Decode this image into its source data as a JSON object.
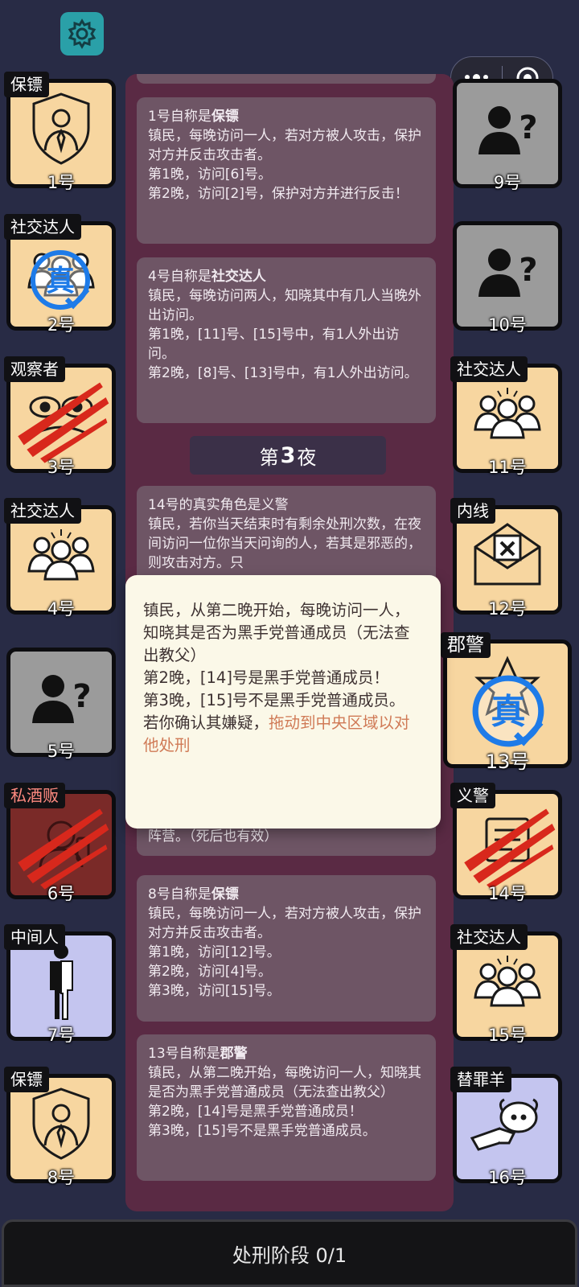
{
  "top": {
    "settings_icon": "gear-icon",
    "menu_icon": "more-dots-icon",
    "record_icon": "target-icon"
  },
  "cards": [
    {
      "lines": [
        "1号自称是",
        "镇民，每晚访问一人，若对方被人攻击，保护对方并反击攻击者。",
        "第1晚，访问[6]号。",
        "第2晚，访问[2]号，保护对方并进行反击！"
      ],
      "claim": "保镖"
    },
    {
      "lines": [
        "4号自称是",
        "镇民，每晚访问两人，知晓其中有几人当晚外出访问。",
        "第1晚，[11]号、[15]号中，有1人外出访问。",
        "第2晚，[8]号、[13]号中，有1人外出访问。"
      ],
      "claim": "社交达人"
    },
    {
      "lines": [
        "14号的真实角色是义警",
        "镇民，若你当天结束时有剩余处刑次数，在夜间访问一位你当天问询的人，若其是邪恶的，则攻击对方。只",
        "阵营。（死后也有效）"
      ]
    },
    {
      "lines": [
        "8号自称是",
        "镇民，每晚访问一人，若对方被人攻击，保护对方并反击攻击者。",
        "第1晚，访问[12]号。",
        "第2晚，访问[4]号。",
        "第3晚，访问[15]号。"
      ],
      "claim": "保镖"
    },
    {
      "lines": [
        "13号自称是",
        "镇民，从第二晚开始，每晚访问一人，知晓其是否为黑手党普通成员（无法查出教父）",
        "第2晚，[14]号是黑手党普通成员！",
        "第3晚，[15]号不是黑手党普通成员。"
      ],
      "claim": "郡警"
    }
  ],
  "night_divider": {
    "prefix": "第",
    "number": "3",
    "suffix": "夜"
  },
  "players": [
    {
      "num": "1号",
      "role": "保镖",
      "style": "peach",
      "portrait": "bodyguard-shield-icon"
    },
    {
      "num": "2号",
      "role": "社交达人",
      "style": "peach",
      "portrait": "crowd-icon",
      "truth": "真"
    },
    {
      "num": "3号",
      "role": "观察者",
      "style": "peach",
      "portrait": "observer-eyes-icon",
      "slashed": true
    },
    {
      "num": "4号",
      "role": "社交达人",
      "style": "peach",
      "portrait": "crowd-icon"
    },
    {
      "num": "5号",
      "role": "",
      "style": "gray",
      "portrait": "unknown-person-icon"
    },
    {
      "num": "6号",
      "role": "私酒贩",
      "style": "darkred",
      "portrait": "bootlegger-icon",
      "slashed": true,
      "role_color": "#ff8a80"
    },
    {
      "num": "7号",
      "role": "中间人",
      "style": "blue",
      "portrait": "middleman-figure-icon"
    },
    {
      "num": "8号",
      "role": "保镖",
      "style": "peach",
      "portrait": "bodyguard-shield-icon"
    },
    {
      "num": "9号",
      "role": "",
      "style": "gray",
      "portrait": "unknown-person-icon"
    },
    {
      "num": "10号",
      "role": "",
      "style": "gray",
      "portrait": "unknown-person-icon"
    },
    {
      "num": "11号",
      "role": "社交达人",
      "style": "peach",
      "portrait": "crowd-icon"
    },
    {
      "num": "12号",
      "role": "内线",
      "style": "peach",
      "portrait": "envelope-x-icon"
    },
    {
      "num": "13号",
      "role": "郡警",
      "style": "peach",
      "portrait": "sheriff-badge-icon",
      "truth": "真"
    },
    {
      "num": "14号",
      "role": "义警",
      "style": "peach",
      "portrait": "vigilante-icon",
      "slashed": true
    },
    {
      "num": "15号",
      "role": "社交达人",
      "style": "peach",
      "portrait": "crowd-icon"
    },
    {
      "num": "16号",
      "role": "替罪羊",
      "style": "blue",
      "portrait": "scapegoat-sheep-icon"
    }
  ],
  "popup": {
    "lines": [
      "镇民，从第二晚开始，每晚访问一人，知晓其是否为黑手党普通成员（无法查出教父）",
      "第2晚，[14]号是黑手党普通成员！",
      "第3晚，[15]号不是黑手党普通成员。",
      "若你确认其嫌疑，"
    ],
    "accent_text": "拖动到中央区域以对他处刑"
  },
  "bottom_bar": {
    "label": "处刑阶段 0/1"
  },
  "colors": {
    "accent": "#d07a56",
    "truth_blue": "#1e7be8",
    "slash_red": "#d8281c"
  }
}
